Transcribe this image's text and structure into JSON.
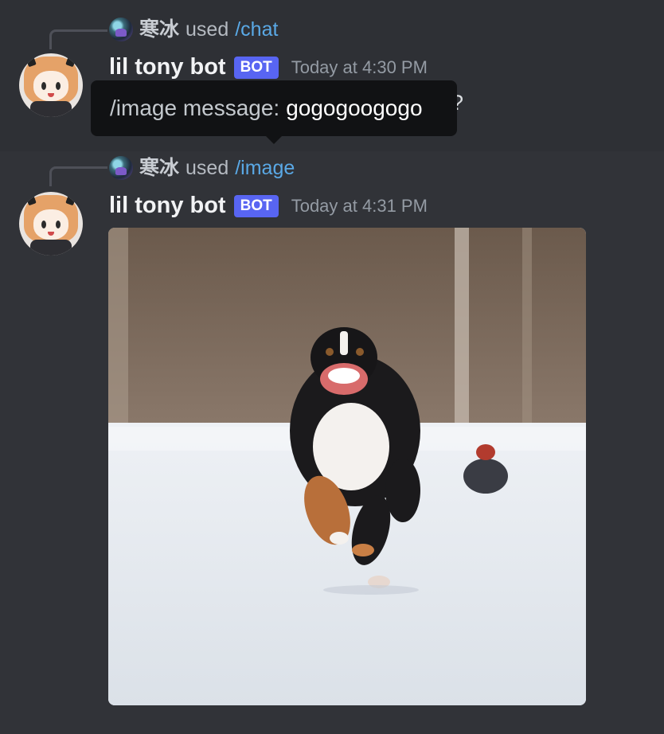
{
  "messages": [
    {
      "reply": {
        "user": "寒冰",
        "used_text": "used",
        "command": "/chat"
      },
      "author": "lil tony bot",
      "badge": "BOT",
      "timestamp": "Today at 4:30 PM",
      "text_tail": "?"
    },
    {
      "reply": {
        "user": "寒冰",
        "used_text": "used",
        "command": "/image"
      },
      "author": "lil tony bot",
      "badge": "BOT",
      "timestamp": "Today at 4:31 PM"
    }
  ],
  "tooltip": {
    "label": "/image message:",
    "value": "gogogoogogo"
  },
  "attachment": {
    "subject": "dog running in snow"
  },
  "colors": {
    "background": "#313338",
    "highlight_row": "#2e3035",
    "bot_badge": "#5865f2",
    "command_link": "#5aa9e6",
    "tooltip_bg": "#111214"
  },
  "icons": {
    "reply_avatar": "user-avatar-icon",
    "bot_avatar": "bot-avatar-icon"
  }
}
